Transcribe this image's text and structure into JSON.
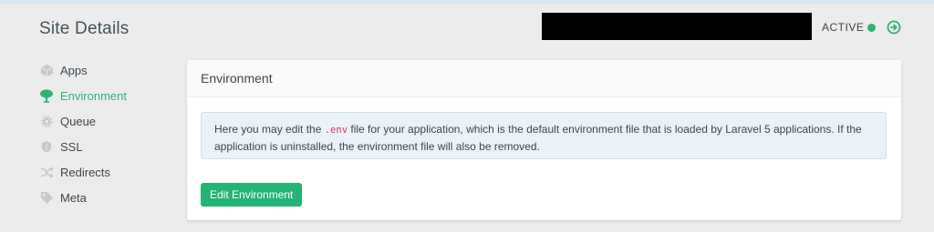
{
  "header": {
    "title": "Site Details",
    "status_text": "ACTIVE",
    "status_color": "#2bb574",
    "goto_icon": "arrow-right-circle-icon"
  },
  "sidebar": {
    "items": [
      {
        "label": "Apps",
        "icon": "box-icon",
        "active": false
      },
      {
        "label": "Environment",
        "icon": "tree-icon",
        "active": true
      },
      {
        "label": "Queue",
        "icon": "gear-icon",
        "active": false
      },
      {
        "label": "SSL",
        "icon": "shield-icon",
        "active": false
      },
      {
        "label": "Redirects",
        "icon": "shuffle-icon",
        "active": false
      },
      {
        "label": "Meta",
        "icon": "tag-icon",
        "active": false
      }
    ]
  },
  "panel": {
    "title": "Environment",
    "info": {
      "before_code": "Here you may edit the ",
      "code": ".env",
      "after_code": " file for your application, which is the default environment file that is loaded by Laravel 5 applications. If the application is uninstalled, the environment file will also be removed."
    },
    "button_label": "Edit Environment"
  },
  "colors": {
    "accent": "#23b476",
    "code": "#d3385d",
    "info_bg": "#eaf1f8"
  }
}
